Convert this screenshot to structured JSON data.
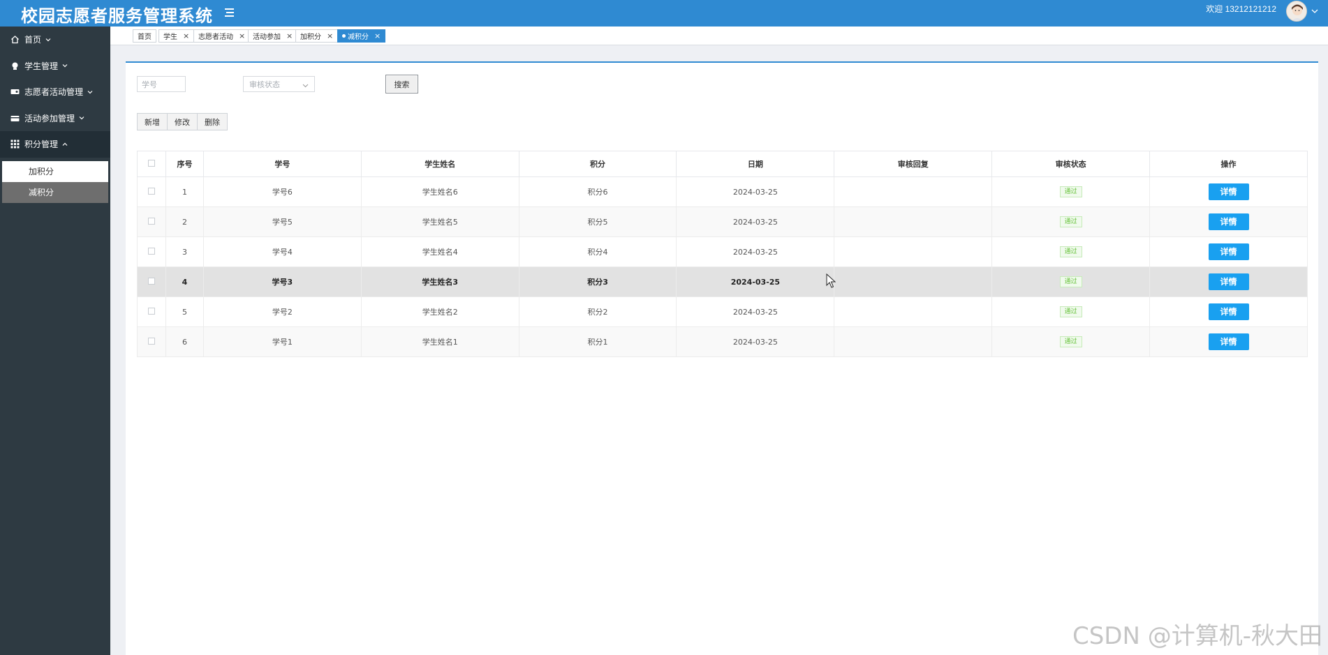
{
  "header": {
    "title": "校园志愿者服务管理系统",
    "welcome": "欢迎 13212121212"
  },
  "sidebar": {
    "items": [
      {
        "label": "首页",
        "icon": "home-icon"
      },
      {
        "label": "学生管理",
        "icon": "user-icon"
      },
      {
        "label": "志愿者活动管理",
        "icon": "card-icon"
      },
      {
        "label": "活动参加管理",
        "icon": "wallet-icon"
      },
      {
        "label": "积分管理",
        "icon": "grid-icon"
      }
    ],
    "sub_items": [
      {
        "label": "加积分"
      },
      {
        "label": "减积分"
      }
    ]
  },
  "tabs": [
    {
      "label": "首页"
    },
    {
      "label": "学生"
    },
    {
      "label": "志愿者活动"
    },
    {
      "label": "活动参加"
    },
    {
      "label": "加积分"
    },
    {
      "label": "减积分"
    }
  ],
  "filters": {
    "student_no_placeholder": "学号",
    "status_placeholder": "审核状态",
    "search_label": "搜索"
  },
  "actions": {
    "add": "新增",
    "edit": "修改",
    "delete": "删除"
  },
  "table": {
    "columns": [
      "序号",
      "学号",
      "学生姓名",
      "积分",
      "日期",
      "审核回复",
      "审核状态",
      "操作"
    ],
    "rows": [
      {
        "index": "1",
        "student_no": "学号6",
        "name": "学生姓名6",
        "points": "积分6",
        "date": "2024-03-25",
        "reply": "",
        "status": "通过",
        "action": "详情"
      },
      {
        "index": "2",
        "student_no": "学号5",
        "name": "学生姓名5",
        "points": "积分5",
        "date": "2024-03-25",
        "reply": "",
        "status": "通过",
        "action": "详情"
      },
      {
        "index": "3",
        "student_no": "学号4",
        "name": "学生姓名4",
        "points": "积分4",
        "date": "2024-03-25",
        "reply": "",
        "status": "通过",
        "action": "详情"
      },
      {
        "index": "4",
        "student_no": "学号3",
        "name": "学生姓名3",
        "points": "积分3",
        "date": "2024-03-25",
        "reply": "",
        "status": "通过",
        "action": "详情"
      },
      {
        "index": "5",
        "student_no": "学号2",
        "name": "学生姓名2",
        "points": "积分2",
        "date": "2024-03-25",
        "reply": "",
        "status": "通过",
        "action": "详情"
      },
      {
        "index": "6",
        "student_no": "学号1",
        "name": "学生姓名1",
        "points": "积分1",
        "date": "2024-03-25",
        "reply": "",
        "status": "通过",
        "action": "详情"
      }
    ]
  },
  "watermark": "CSDN @计算机-秋大田",
  "colors": {
    "header": "#2f8ad2",
    "sidebar": "#2e3a42",
    "detail_button": "#19a0f0",
    "status_green": "#67c23a"
  }
}
